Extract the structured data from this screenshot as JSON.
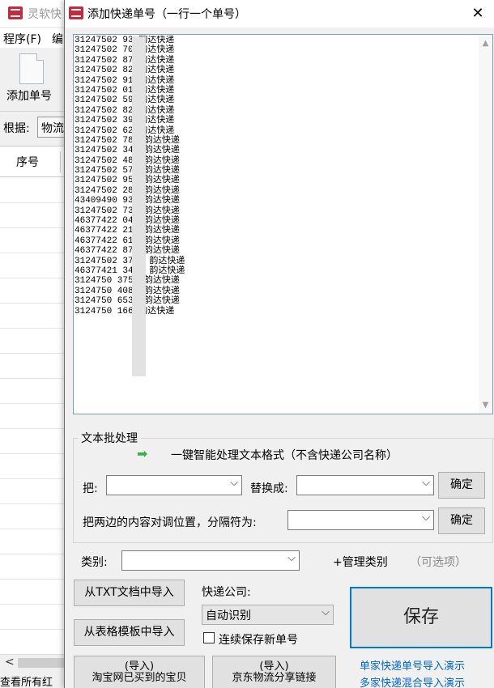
{
  "background_window": {
    "title": "灵软快",
    "menu": [
      "程序(F)",
      "编"
    ],
    "add_button_label": "添加单号",
    "basis_label": "根据:",
    "basis_value": "物流",
    "column_header": "序号",
    "status_text": "查看所有红"
  },
  "dialog": {
    "title": "添加快递单号（一行一个单号）",
    "close_icon": "close-icon",
    "tracking_lines": [
      "31247502 93 韵达快递",
      "31247502 70 韵达快递",
      "31247502 87 韵达快递",
      "31247502 82 韵达快递",
      "31247502 91 韵达快递",
      "31247502 01 韵达快递",
      "31247502 59 韵达快递",
      "31247502 82 韵达快递",
      "31247502 39 韵达快递",
      "31247502 62 韵达快递",
      "31247502 787 韵达快递",
      "31247502 345 韵达快递",
      "31247502 485 韵达快递",
      "31247502 579 韵达快递",
      "31247502 959 韵达快递",
      "31247502 281 韵达快递",
      "43409490 932 韵达快递",
      "31247502 736 韵达快递",
      "46377422 045 韵达快递",
      "46377422 214 韵达快递",
      "46377422 612 韵达快递",
      "46377422 871 韵达快递",
      "31247502 3746 韵达快递",
      "46377421 3488 韵达快递",
      "3124750 3752 韵达快递",
      "3124750 4081 韵达快递",
      "3124750 6535 韵达快递",
      "3124750 166 韵达快递"
    ],
    "batch": {
      "group_title": "文本批处理",
      "smart_format": "一键智能处理文本格式（不含快递公司名称）",
      "replace_from_label": "把:",
      "replace_from_value": "",
      "replace_to_label": "替换成:",
      "replace_to_value": "",
      "confirm_label": "确定",
      "swap_label": "把两边的内容对调位置，分隔符为:",
      "swap_value": "",
      "confirm2_label": "确定"
    },
    "category": {
      "label": "类别:",
      "value": "",
      "manage_label": "+管理类别",
      "optional": "（可选项）"
    },
    "import": {
      "from_txt": "从TXT文档中导入",
      "from_template": "从表格模板中导入",
      "taobao_top": "(导入)",
      "taobao_bottom": "淘宝网已买到的宝贝",
      "jd_top": "(导入)",
      "jd_bottom": "京东物流分享链接"
    },
    "courier": {
      "label": "快递公司:",
      "value": "自动识别",
      "continuous_save": "连续保存新单号"
    },
    "save_label": "保存",
    "links": [
      "单家快递单号导入演示",
      "多家快递混合导入演示"
    ]
  }
}
